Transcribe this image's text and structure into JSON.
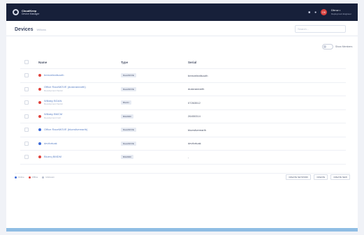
{
  "topbar": {
    "app_name": "CloudKeep",
    "app_subtitle": "Device Manager",
    "user_initials": "DS",
    "user_name": "Dhruv •",
    "user_role": "Deployment Engineer"
  },
  "page": {
    "title": "Devices",
    "breadcrumb": "Willows",
    "search_placeholder": "Search..."
  },
  "toggle": {
    "label": "Show Members"
  },
  "table": {
    "headers": {
      "name": "Name",
      "type": "Type",
      "serial": "Serial"
    },
    "rows": [
      {
        "name": "breezeleafsouth",
        "sub": "",
        "type": "RaceMOVE",
        "serial": "breezeleafsouth",
        "color": "#e0413b"
      },
      {
        "name": "Office RaceMOVE (duskranearth)",
        "sub": "Development Sector",
        "type": "RaceMOVE",
        "serial": "duskranearth",
        "color": "#e0413b"
      },
      {
        "name": "Willaby BGAN",
        "sub": "Development Sector",
        "type": "BGAN",
        "serial": "07263512",
        "color": "#e0413b"
      },
      {
        "name": "Willaby BMCM",
        "sub": "Development Cell",
        "type": "BGM300",
        "serial": "26450314",
        "color": "#e0413b"
      },
      {
        "name": "Office RaceMOVE (bluesilverearth)",
        "sub": "",
        "type": "RaceMOVE",
        "serial": "bluesilverearth",
        "color": "#3c6ad8"
      },
      {
        "name": "devfortuak",
        "sub": "",
        "type": "RaceMOVE",
        "serial": "devfortuak",
        "color": "#3c6ad8"
      },
      {
        "name": "Bluerq BMDM",
        "sub": "",
        "type": "BGM300",
        "serial": "-",
        "color": "#e0413b"
      }
    ]
  },
  "footer": {
    "legend": [
      {
        "label": "Online",
        "color": "#3c6ad8"
      },
      {
        "label": "Offline",
        "color": "#e0413b"
      },
      {
        "label": "Unknown",
        "color": "#b8bfcf"
      }
    ],
    "actions": [
      "CREATE NETWORK",
      "CREATE",
      "CREATE NEW"
    ]
  }
}
